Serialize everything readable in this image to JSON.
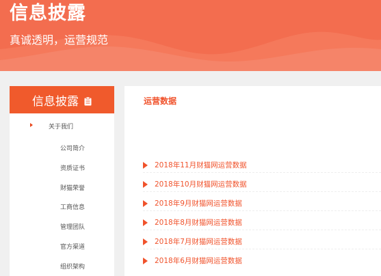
{
  "banner": {
    "title": "信息披露",
    "subtitle": "真诚透明，运营规范"
  },
  "sidebar": {
    "header": "信息披露",
    "main_item": "关于我们",
    "sub_items": [
      "公司简介",
      "资质证书",
      "财猫荣誉",
      "工商信息",
      "管理团队",
      "官方渠道",
      "组织架构"
    ]
  },
  "content": {
    "title": "运营数据",
    "links": [
      "2018年11月财猫网运营数据",
      "2018年10月财猫网运营数据",
      "2018年9月财猫网运营数据",
      "2018年8月财猫网运营数据",
      "2018年7月财猫网运营数据",
      "2018年6月财猫网运营数据"
    ]
  },
  "colors": {
    "banner_bg": "#f36d4f",
    "accent": "#f05a2c",
    "link": "#f0522b"
  },
  "icons": {
    "header_icon": "clipboard-icon",
    "bullet": "triangle-right-icon"
  }
}
